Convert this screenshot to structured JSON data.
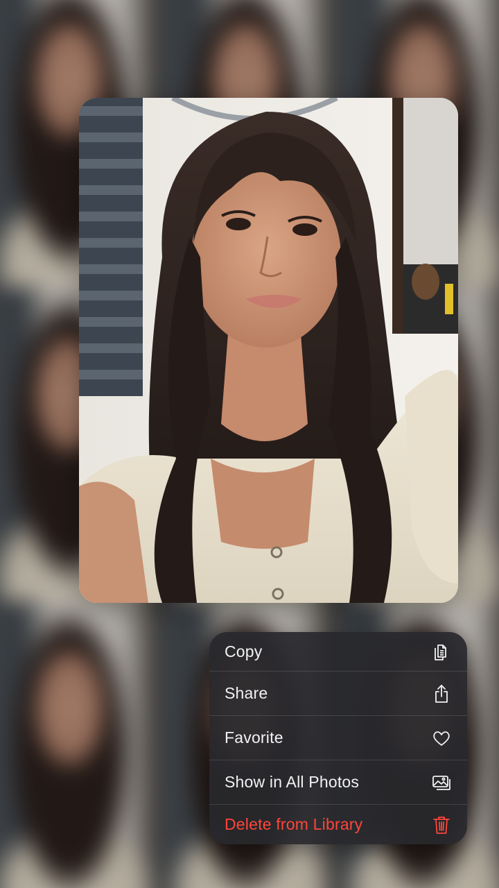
{
  "context_menu": {
    "items": [
      {
        "label": "Copy",
        "icon": "copy-icon",
        "destructive": false
      },
      {
        "label": "Share",
        "icon": "share-icon",
        "destructive": false
      },
      {
        "label": "Favorite",
        "icon": "heart-icon",
        "destructive": false
      },
      {
        "label": "Show in All Photos",
        "icon": "photo-library-icon",
        "destructive": false
      },
      {
        "label": "Delete from Library",
        "icon": "trash-icon",
        "destructive": true
      }
    ]
  },
  "colors": {
    "menu_background": "#28282c",
    "menu_text": "#f2f2f4",
    "destructive": "#ff453a"
  }
}
